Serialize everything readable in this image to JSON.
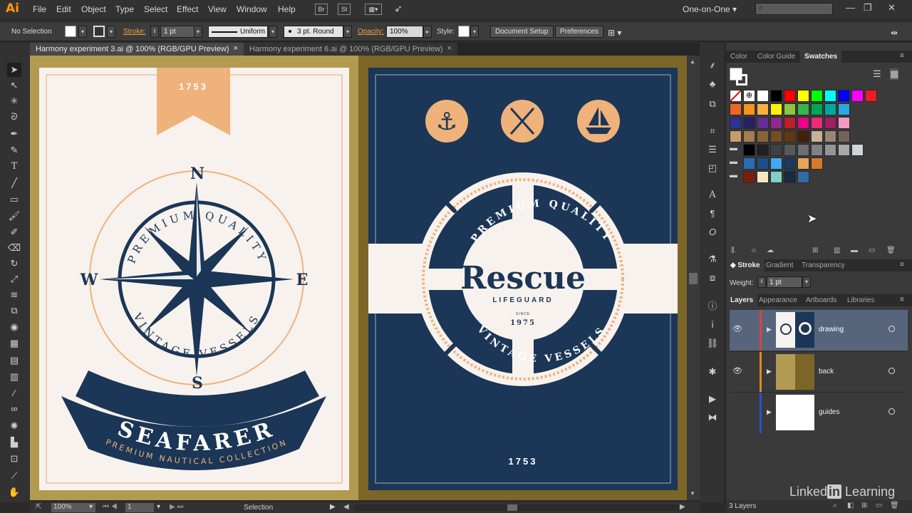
{
  "app": {
    "logo": "Ai"
  },
  "menu": [
    "File",
    "Edit",
    "Object",
    "Type",
    "Select",
    "Effect",
    "View",
    "Window",
    "Help"
  ],
  "menubar_icons": {
    "bridge": "Br",
    "stock": "St"
  },
  "workspace": "One-on-One",
  "control": {
    "selection": "No Selection",
    "stroke_label": "Stroke:",
    "stroke_weight": "1 pt",
    "stroke_profile": "Uniform",
    "brush": "3 pt. Round",
    "opacity_label": "Opacity:",
    "opacity": "100%",
    "style_label": "Style:",
    "document_setup": "Document Setup",
    "preferences": "Preferences"
  },
  "tabs": [
    {
      "label": "Harmony experiment 3.ai @ 100% (RGB/GPU Preview)",
      "close": "×"
    },
    {
      "label": "Harmony experiment 6.ai @ 100% (RGB/GPU Preview)",
      "close": "×"
    }
  ],
  "art_left": {
    "year": "1753",
    "arc_top": "PREMIUM QUALITY",
    "arc_bottom": "VINTAGE VESSELS",
    "north": "N",
    "south": "S",
    "west": "W",
    "east": "E",
    "banner": "SEAFARER",
    "subtitle": "PREMIUM NAUTICAL COLLECTION"
  },
  "art_right": {
    "title": "Rescue",
    "subtitle": "LIFEGUARD",
    "since": "SINCE",
    "year": "1975",
    "arc_top": "PREMIUM QUALITY",
    "arc_bottom": "VINTAGE VESSELS",
    "bottom_year": "1753"
  },
  "swatches_panel": {
    "tabs": [
      "Color",
      "Color Guide",
      "Swatches"
    ],
    "rows": [
      [
        "#ffffff",
        "#000000",
        "#ff0000",
        "#ffff00",
        "#00ff00",
        "#00ffff",
        "#0000ff",
        "#ff00ff",
        "#ed1c24"
      ],
      [
        "#f26522",
        "#f7941d",
        "#fbb040",
        "#fff200",
        "#8dc63f",
        "#39b54a",
        "#00a651",
        "#00a99d",
        "#27aae1"
      ],
      [
        "#2e3192",
        "#262262",
        "#662d91",
        "#92278f",
        "#be1e2d",
        "#ec008c",
        "#ee2a7b",
        "#9e1f63",
        "#f49ac1"
      ],
      [
        "#c69c6d",
        "#a67c52",
        "#8c6239",
        "#754c24",
        "#603913",
        "#42210b",
        "#c7b299",
        "#998675",
        "#736357"
      ],
      [
        "#000000",
        "#231f20",
        "#414042",
        "#58595b",
        "#6d6e71",
        "#808285",
        "#939598",
        "#a7a9ac",
        "#d1d3d4"
      ],
      [
        "#2b6cb0",
        "#1d4e89",
        "#3fa9f5",
        "#1b3a5c",
        "#e8a45a",
        "#d97a2b"
      ],
      [
        "#7a1f0e",
        "#f6e7c1",
        "#7fd1c7",
        "#1a2a44",
        "#2e6da4"
      ]
    ]
  },
  "stroke_panel": {
    "tabs": [
      "Stroke",
      "Gradient",
      "Transparency"
    ],
    "weight_label": "Weight:",
    "weight": "1 pt"
  },
  "layers_panel": {
    "tabs": [
      "Layers",
      "Appearance",
      "Artboards",
      "Libraries"
    ],
    "layers": [
      {
        "name": "drawing",
        "color": "#e04040"
      },
      {
        "name": "back",
        "color": "#e08a20"
      },
      {
        "name": "guides",
        "color": "#3050d0"
      }
    ],
    "count": "3 Layers"
  },
  "status": {
    "zoom": "100%",
    "artboard": "1",
    "tool": "Selection"
  },
  "watermark": "Linked in Learning"
}
